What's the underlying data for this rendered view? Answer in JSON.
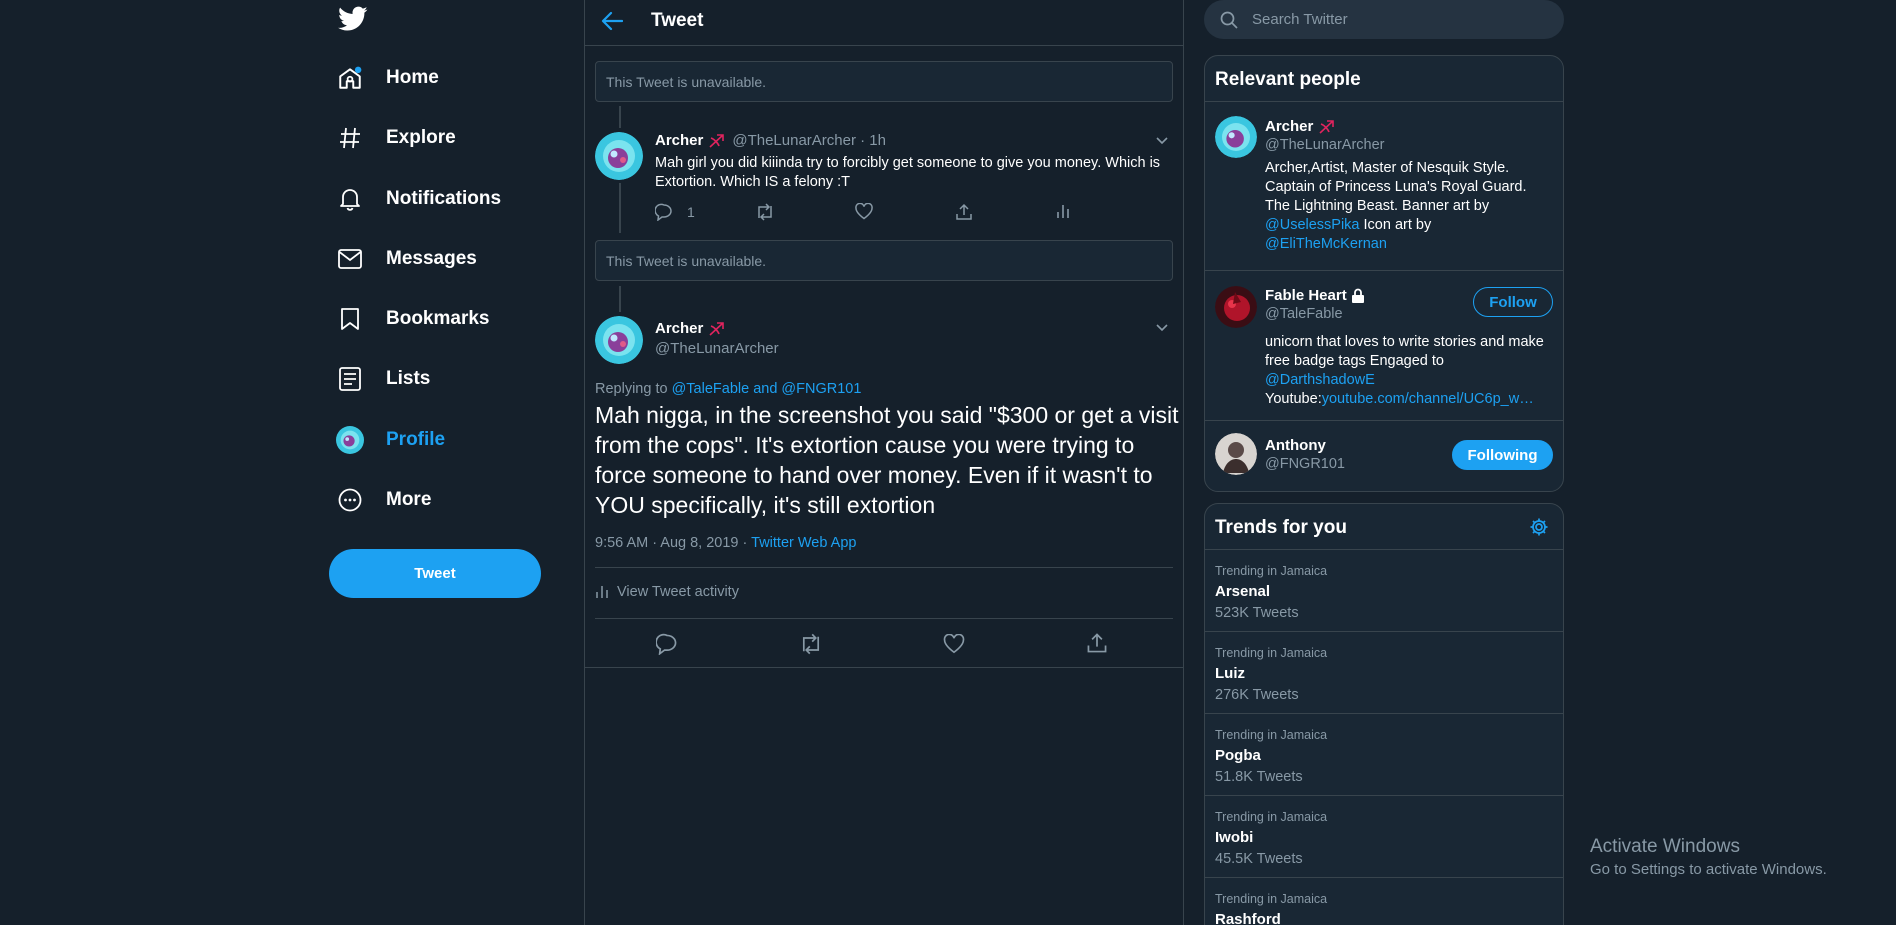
{
  "nav": {
    "items": [
      {
        "label": "Home",
        "icon": "home-icon"
      },
      {
        "label": "Explore",
        "icon": "hashtag-icon"
      },
      {
        "label": "Notifications",
        "icon": "bell-icon"
      },
      {
        "label": "Messages",
        "icon": "mail-icon"
      },
      {
        "label": "Bookmarks",
        "icon": "bookmark-icon"
      },
      {
        "label": "Lists",
        "icon": "list-icon"
      },
      {
        "label": "Profile",
        "icon": "avatar"
      },
      {
        "label": "More",
        "icon": "more-icon"
      }
    ],
    "tweet_button": "Tweet",
    "accent": "#1da1f2"
  },
  "center": {
    "header_title": "Tweet",
    "unavailable_1": "This Tweet is unavailable.",
    "unavailable_2": "This Tweet is unavailable.",
    "reply": {
      "name": "Archer",
      "handle_time": "@TheLunarArcher · 1h",
      "text": "Mah girl you did kiiinda try to forcibly get someone to give you money. Which is Extortion. Which IS a felony :T",
      "reply_count": "1"
    },
    "main": {
      "name": "Archer",
      "handle": "@TheLunarArcher",
      "replying_prefix": "Replying to",
      "replying_to": "@TaleFable and @FNGR101",
      "text": "Mah nigga, in the screenshot you said \"$300 or get a visit from the cops\". It's extortion cause you were trying to force someone to hand over money. Even if it wasn't to YOU specifically, it's still extortion",
      "timestamp": "9:56 AM · Aug 8, 2019 ·",
      "source": "Twitter Web App",
      "activity": "View Tweet activity"
    }
  },
  "search": {
    "placeholder": "Search Twitter"
  },
  "relevant": {
    "title": "Relevant people",
    "people": [
      {
        "name": "Archer",
        "handle": "@TheLunarArcher",
        "bio_1": "Archer,Artist, Master of Nesquik Style. Captain of Princess Luna's Royal Guard. The Lightning Beast. Banner art by",
        "bio_link_1": "@UselessPika",
        "bio_2": "Icon art by",
        "bio_link_2": "@EliTheMcKernan"
      },
      {
        "name": "Fable Heart",
        "handle": "@TaleFable",
        "button": "Follow",
        "bio_1": "unicorn that loves to write stories and make free badge tags Engaged to",
        "bio_link_1": "@DarthshadowE",
        "bio_2": "Youtube:",
        "bio_link_2": "youtube.com/channel/UC6p_w…"
      },
      {
        "name": "Anthony",
        "handle": "@FNGR101",
        "button": "Following"
      }
    ]
  },
  "trends": {
    "title": "Trends for you",
    "items": [
      {
        "context": "Trending in Jamaica",
        "name": "Arsenal",
        "count": "523K Tweets"
      },
      {
        "context": "Trending in Jamaica",
        "name": "Luiz",
        "count": "276K Tweets"
      },
      {
        "context": "Trending in Jamaica",
        "name": "Pogba",
        "count": "51.8K Tweets"
      },
      {
        "context": "Trending in Jamaica",
        "name": "Iwobi",
        "count": "45.5K Tweets"
      },
      {
        "context": "Trending in Jamaica",
        "name": "Rashford",
        "count": ""
      }
    ]
  },
  "windows": {
    "activate_title": "Activate Windows",
    "activate_sub": "Go to Settings to activate Windows."
  }
}
